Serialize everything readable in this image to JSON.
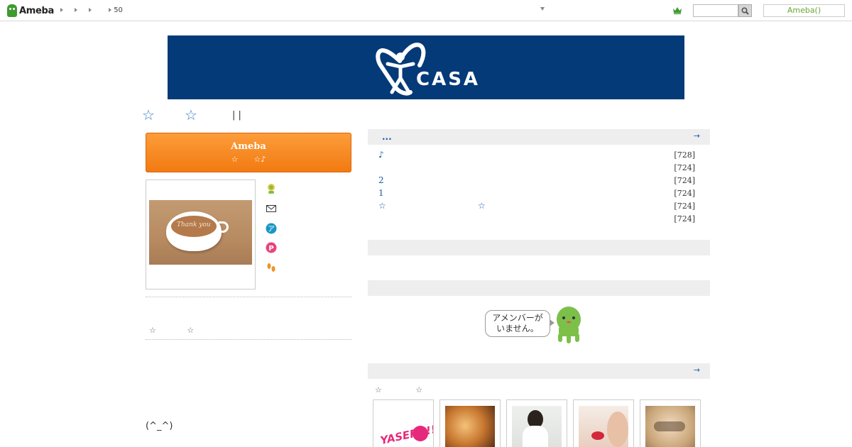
{
  "header": {
    "logo_text": "Ameba",
    "breadcrumb_count": "50",
    "login_label": "Ameba()"
  },
  "banner": {
    "brand": "CASA"
  },
  "blog_title": {
    "star_left": "☆",
    "star_right": "☆",
    "separator": "|  |"
  },
  "promo": {
    "title": "Ameba",
    "subtitle": "☆　　☆♪"
  },
  "profile": {
    "cup_text": "Thank you",
    "small_stars": "☆ ☆",
    "smiley": "(^_^)"
  },
  "entries": {
    "title": "...",
    "more": "→",
    "items": [
      {
        "title": "♪",
        "count": "[728]"
      },
      {
        "title": "",
        "count": "[724]"
      },
      {
        "title": "2",
        "count": "[724]"
      },
      {
        "title": "1",
        "count": "[724]"
      },
      {
        "title": "☆",
        "count": "[724]"
      },
      {
        "title": "",
        "count": "[724]"
      }
    ],
    "mid_star": "☆"
  },
  "amember": {
    "message_line1": "アメンバーが",
    "message_line2": "いません。"
  },
  "readers": {
    "more": "→",
    "stars": "☆ ☆",
    "thumb1_text": "YASERU!!"
  },
  "colors": {
    "brand_green": "#3e9b2f",
    "banner_navy": "#053a78",
    "promo_orange": "#f27a12",
    "link_blue": "#1a5fa8"
  }
}
